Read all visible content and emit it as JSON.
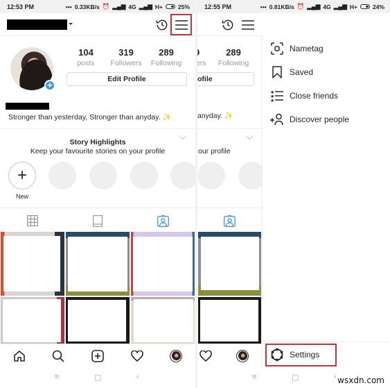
{
  "left": {
    "status": {
      "time": "12:53 PM",
      "network": "0.33KB/s",
      "network_type": "4G",
      "carrier2": "H+",
      "battery": "25%"
    },
    "header": {
      "username": "[redacted]",
      "history_icon": "history-icon",
      "menu_icon": "hamburger-menu-icon"
    },
    "profile": {
      "stats": [
        {
          "value": "104",
          "label": "posts"
        },
        {
          "value": "319",
          "label": "Followers"
        },
        {
          "value": "289",
          "label": "Following"
        }
      ],
      "edit_profile_label": "Edit Profile",
      "bio": "Stronger than yesterday, Stronger than anyday.",
      "bio_emoji": "✨"
    },
    "highlights": {
      "title": "Story Highlights",
      "subtitle": "Keep your favourite stories on your profile",
      "new_label": "New",
      "new_symbol": "+"
    },
    "tabs": [
      {
        "name": "grid",
        "icon": "grid-icon",
        "active": false
      },
      {
        "name": "feed",
        "icon": "feed-icon",
        "active": false
      },
      {
        "name": "tagged",
        "icon": "tagged-icon",
        "active": true
      }
    ],
    "bottom_nav": [
      {
        "name": "home",
        "icon": "home-icon"
      },
      {
        "name": "search",
        "icon": "search-icon"
      },
      {
        "name": "add",
        "icon": "add-post-icon"
      },
      {
        "name": "activity",
        "icon": "heart-icon"
      },
      {
        "name": "profile",
        "icon": "profile-avatar"
      }
    ]
  },
  "right": {
    "status": {
      "time": "12:55 PM",
      "network": "0.81KB/s",
      "network_type": "4G",
      "carrier2": "H+",
      "battery": "24%"
    },
    "partial": {
      "stat_num_partial": "9",
      "stat_lbl_partial": "ers",
      "following_value": "289",
      "following_label": "Following",
      "edit_partial": "ofile",
      "hl_sub_partial": "our profile"
    },
    "menu": {
      "items": [
        {
          "label": "Nametag",
          "icon": "nametag-icon"
        },
        {
          "label": "Saved",
          "icon": "bookmark-icon"
        },
        {
          "label": "Close friends",
          "icon": "close-friends-icon"
        },
        {
          "label": "Discover people",
          "icon": "discover-people-icon"
        }
      ],
      "settings_label": "Settings"
    }
  },
  "system_nav": {
    "menu": "≡",
    "home": "▢",
    "back": "‹"
  },
  "highlight_color": "#d32f3a",
  "accent_color": "#3897f0",
  "watermark": "wsxdn.com"
}
